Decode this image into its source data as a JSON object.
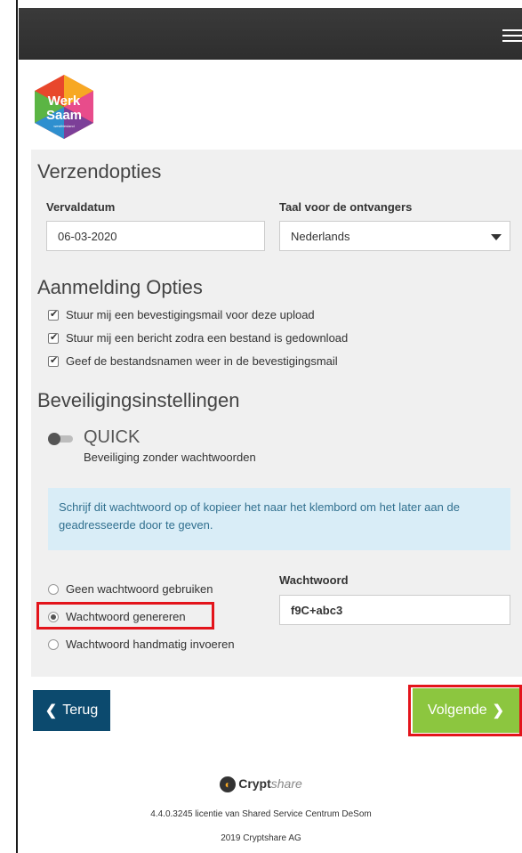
{
  "logo": {
    "line1": "Werk",
    "line2": "Saam",
    "tagline": "westfriesland"
  },
  "sections": {
    "send_options": {
      "title": "Verzendopties",
      "expiry_label": "Vervaldatum",
      "expiry_value": "06-03-2020",
      "language_label": "Taal voor de ontvangers",
      "language_value": "Nederlands"
    },
    "notification_options": {
      "title": "Aanmelding Opties",
      "checks": [
        "Stuur mij een bevestigingsmail voor deze upload",
        "Stuur mij een bericht zodra een bestand is gedownload",
        "Geef de bestandsnamen weer in de bevestigingsmail"
      ]
    },
    "security": {
      "title": "Beveiligingsinstellingen",
      "mode": "QUICK",
      "mode_desc": "Beveiliging zonder wachtwoorden",
      "info": "Schrijf dit wachtwoord op of kopieer het naar het klembord om het later aan de geadresseerde door te geven.",
      "radios": [
        "Geen wachtwoord gebruiken",
        "Wachtwoord genereren",
        "Wachtwoord handmatig invoeren"
      ],
      "password_label": "Wachtwoord",
      "password_value": "f9C+abc3"
    }
  },
  "buttons": {
    "back": "Terug",
    "next": "Volgende"
  },
  "footer": {
    "brand_bold": "Crypt",
    "brand_light": "share",
    "license": "4.4.0.3245 licentie van Shared Service Centrum DeSom",
    "copyright": "2019 Cryptshare AG"
  },
  "colors": {
    "topbar": "#333333",
    "back_button": "#0c4a6e",
    "next_button": "#8cc63f",
    "highlight": "#e3141b",
    "info_bg": "#d9edf7"
  }
}
